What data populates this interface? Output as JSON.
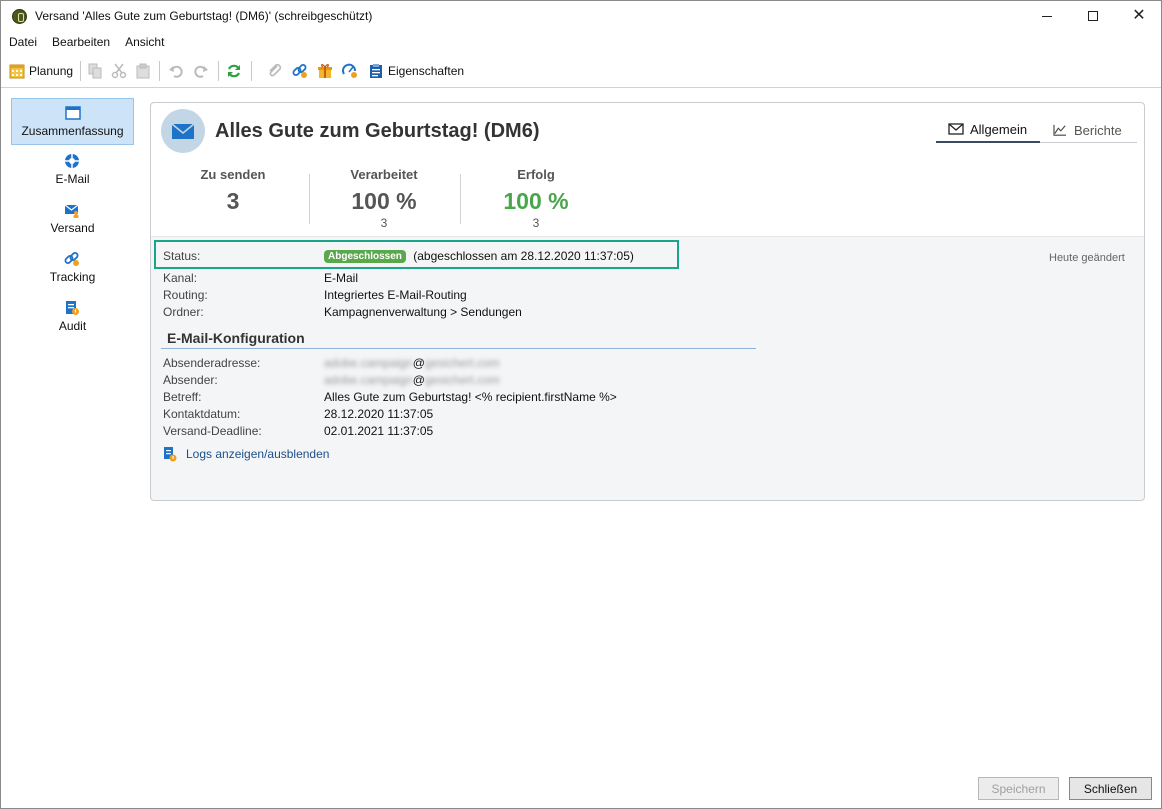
{
  "window": {
    "title": "Versand 'Alles Gute zum Geburtstag! (DM6)' (schreibgeschützt)",
    "minimize_icon": "minimize-icon",
    "maximize_icon": "maximize-icon",
    "close_icon": "close-icon"
  },
  "menu": [
    "Datei",
    "Bearbeiten",
    "Ansicht"
  ],
  "toolbar": {
    "planung_label": "Planung",
    "eigenschaften_label": "Eigenschaften"
  },
  "nav": {
    "items": [
      {
        "label": "Zusammenfassung",
        "icon": "window-icon",
        "active": true
      },
      {
        "label": "E-Mail",
        "icon": "lifebuoy-icon"
      },
      {
        "label": "Versand",
        "icon": "envelope-person-icon"
      },
      {
        "label": "Tracking",
        "icon": "link-icon"
      },
      {
        "label": "Audit",
        "icon": "audit-icon"
      }
    ]
  },
  "header": {
    "title": "Alles Gute zum Geburtstag! (DM6)",
    "tabs": [
      {
        "label": "Allgemein",
        "icon": "envelope-icon",
        "active": true
      },
      {
        "label": "Berichte",
        "icon": "line-chart-icon"
      }
    ]
  },
  "stats": [
    {
      "label": "Zu senden",
      "value": "3",
      "sub": ""
    },
    {
      "label": "Verarbeitet",
      "value": "100 %",
      "sub": "3"
    },
    {
      "label": "Erfolg",
      "value": "100 %",
      "sub": "3",
      "color": "#4aa64a"
    }
  ],
  "details": {
    "status_label": "Status:",
    "status_badge": "Abgeschlossen",
    "status_text": "(abgeschlossen am  28.12.2020 11:37:05)",
    "heute": "Heute geändert",
    "kanal_label": "Kanal:",
    "kanal_value": "E-Mail",
    "routing_label": "Routing:",
    "routing_value": "Integriertes E-Mail-Routing",
    "ordner_label": "Ordner:",
    "ordner_value": "Kampagnenverwaltung > Sendungen"
  },
  "email_config": {
    "title": "E-Mail-Konfiguration",
    "absenderadresse_label": "Absenderadresse:",
    "absenderadresse_value_pre": "adobe.campaign",
    "absenderadresse_at": "@",
    "absenderadresse_value_post": "gesichert.com",
    "absender_label": "Absender:",
    "absender_value_pre": "adobe.campaign",
    "absender_at": "@",
    "absender_value_post": "gesichert.com",
    "betreff_label": "Betreff:",
    "betreff_value": "Alles Gute zum Geburtstag! <% recipient.firstName %>",
    "kontaktdatum_label": "Kontaktdatum:",
    "kontaktdatum_value": "28.12.2020 11:37:05",
    "deadline_label": "Versand-Deadline:",
    "deadline_value": "02.01.2021 11:37:05",
    "logs_link": "Logs anzeigen/ausblenden"
  },
  "footer": {
    "save_label": "Speichern",
    "close_label": "Schließen"
  },
  "colors": {
    "accent": "#1e73c8",
    "success": "#4aa64a",
    "highlight_border": "#1aa58a",
    "nav_active": "#cde3f7"
  }
}
